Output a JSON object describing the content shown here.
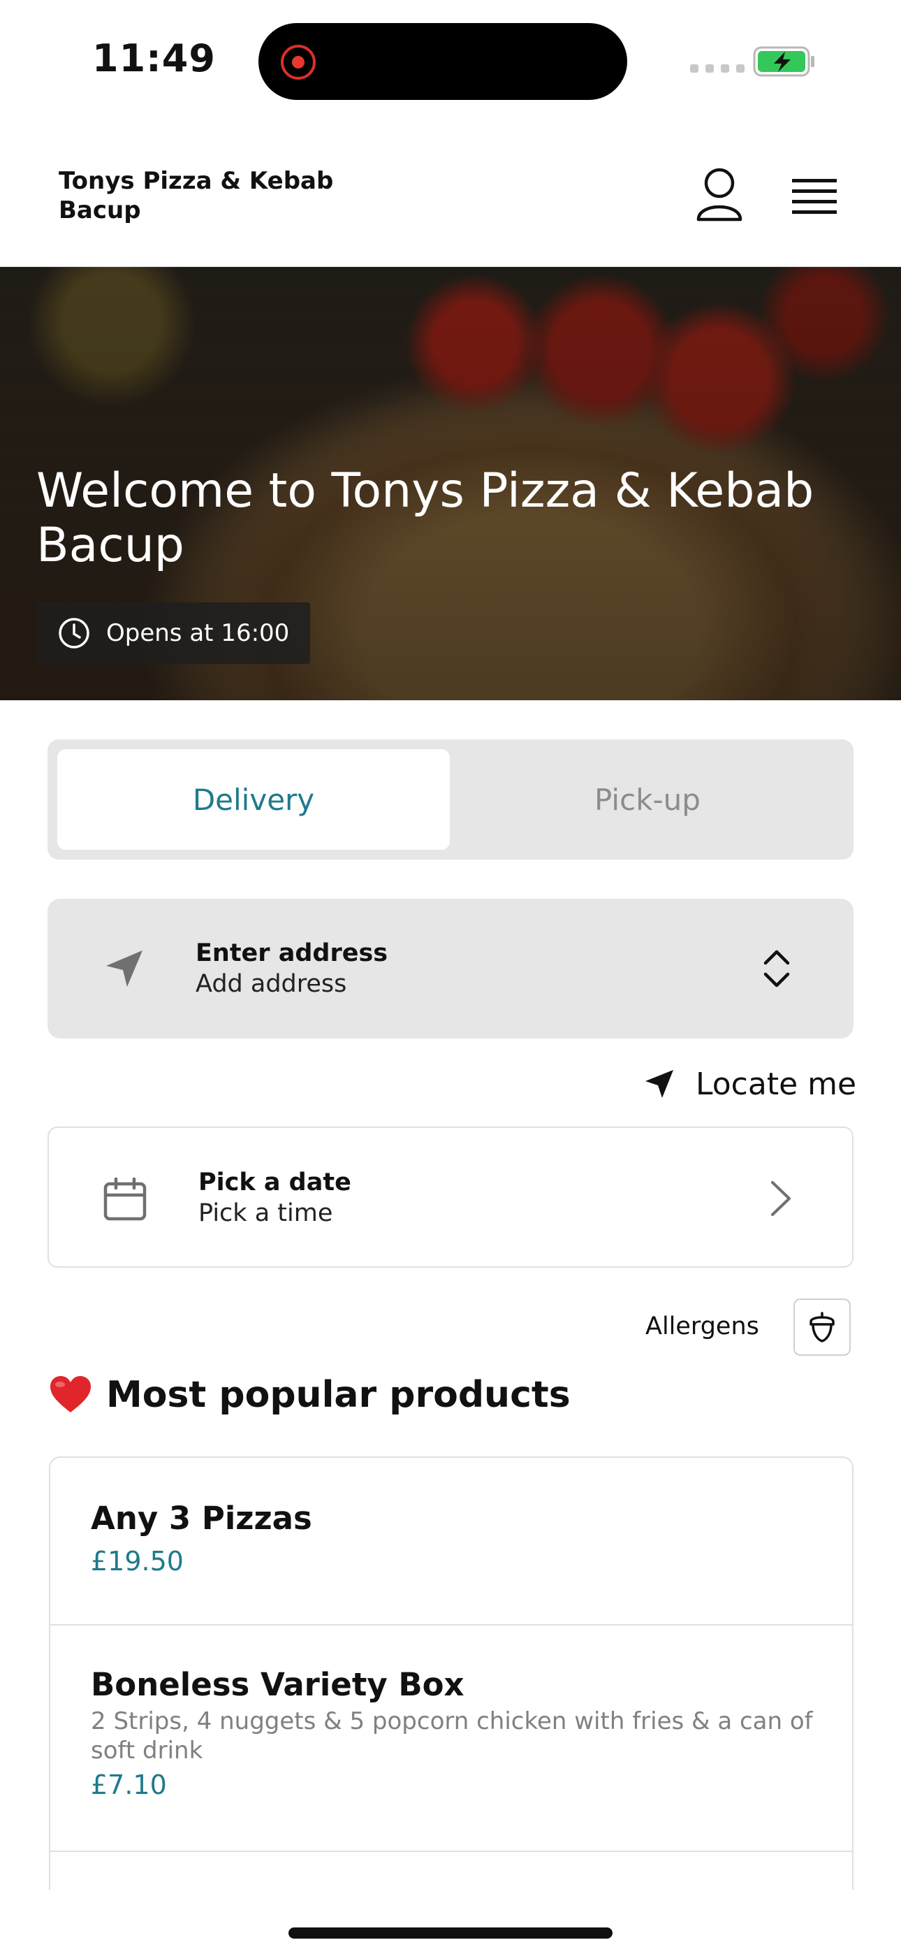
{
  "status_bar": {
    "time": "11:49"
  },
  "header": {
    "restaurant_name": "Tonys Pizza & Kebab Bacup"
  },
  "hero": {
    "title": "Welcome to Tonys Pizza & Kebab Bacup",
    "opens_text": "Opens at 16:00"
  },
  "mode_toggle": {
    "delivery_label": "Delivery",
    "pickup_label": "Pick-up",
    "selected": "Delivery"
  },
  "address": {
    "title": "Enter address",
    "subtitle": "Add address"
  },
  "locate": {
    "label": "Locate me"
  },
  "schedule": {
    "date_label": "Pick a date",
    "time_label": "Pick a time"
  },
  "allergens": {
    "label": "Allergens"
  },
  "popular": {
    "heading": "Most popular products",
    "products": [
      {
        "name": "Any 3 Pizzas",
        "description": "",
        "price": "£19.50"
      },
      {
        "name": "Boneless Variety Box",
        "description": "2 Strips, 4 nuggets & 5 popcorn chicken with fries & a can of soft drink",
        "price": "£7.10"
      }
    ]
  },
  "colors": {
    "accent": "#1f7a8c",
    "toggle_bg": "#e6e6e6",
    "battery_green": "#34c759"
  },
  "icons": [
    "profile-icon",
    "menu-icon",
    "clock-icon",
    "navigation-arrow-icon",
    "up-down-chevron-icon",
    "calendar-icon",
    "chevron-right-icon",
    "acorn-icon",
    "heart-icon"
  ]
}
